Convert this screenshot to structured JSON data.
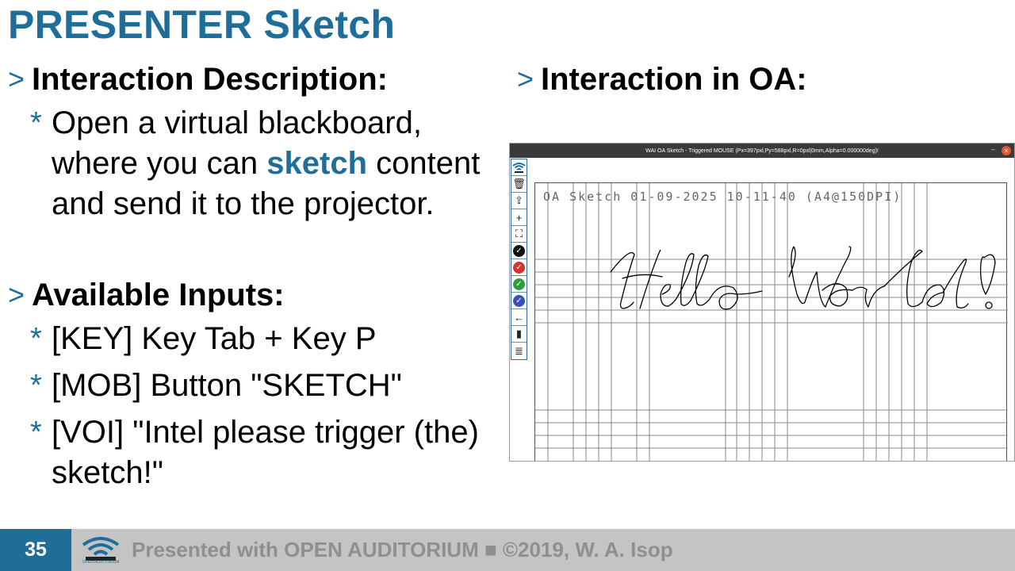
{
  "slide": {
    "title": "PRESENTER Sketch",
    "page_number": "35"
  },
  "left": {
    "arrow": ">",
    "sections": [
      {
        "title": "Interaction Description:",
        "bullets": [
          {
            "parts": [
              "Open a virtual blackboard, where you can ",
              "sketch",
              " content and send it to the projector."
            ]
          }
        ]
      },
      {
        "title": "Available Inputs:",
        "bullets": [
          {
            "text": "[KEY] Key Tab + Key P"
          },
          {
            "text": "[MOB] Button \"SKETCH\""
          },
          {
            "text": "[VOI] \"Intel please trigger (the) sketch!\""
          }
        ]
      }
    ],
    "bullet_marker": "*"
  },
  "right": {
    "title": "Interaction in OA:",
    "window": {
      "title": "WAI OA Sketch - Triggered MOUSE (Px=397pxl,Py=588pxl,R=0pxl|0mm,Alpha=0.000000deg)!",
      "minimize": "–",
      "close": "×",
      "canvas_title": "OA Sketch 01-09-2025 10-11-40 (A4@150DPI)",
      "handwriting": "Hello World!",
      "tools": [
        {
          "icon": "wifi-logo-icon"
        },
        {
          "icon": "trash-icon",
          "glyph": "🗑"
        },
        {
          "icon": "export-icon",
          "glyph": "⇪"
        },
        {
          "icon": "crosshair-icon",
          "glyph": "+"
        },
        {
          "icon": "fullscreen-icon",
          "glyph": "⛶"
        },
        {
          "icon": "black-check-icon",
          "glyph": "✓",
          "color": "#111111"
        },
        {
          "icon": "red-check-icon",
          "glyph": "✓",
          "color": "#d9322b"
        },
        {
          "icon": "green-check-icon",
          "glyph": "✓",
          "color": "#2c9e3f"
        },
        {
          "icon": "blue-check-icon",
          "glyph": "✓",
          "color": "#3a4fbf"
        },
        {
          "icon": "back-arrow-icon",
          "glyph": "←"
        },
        {
          "icon": "black-page-icon",
          "glyph": "▮"
        },
        {
          "icon": "lined-page-icon",
          "glyph": "≣"
        }
      ]
    }
  },
  "footer": {
    "text": "Presented with OPEN AUDITORIUM ■ ©2019, W. A. Isop",
    "logo_caption": "OPEN AUDITORIUM"
  },
  "colors": {
    "accent": "#1f6e99",
    "footer_bg": "#c4c4c4",
    "footer_text": "#8f8f8f"
  }
}
